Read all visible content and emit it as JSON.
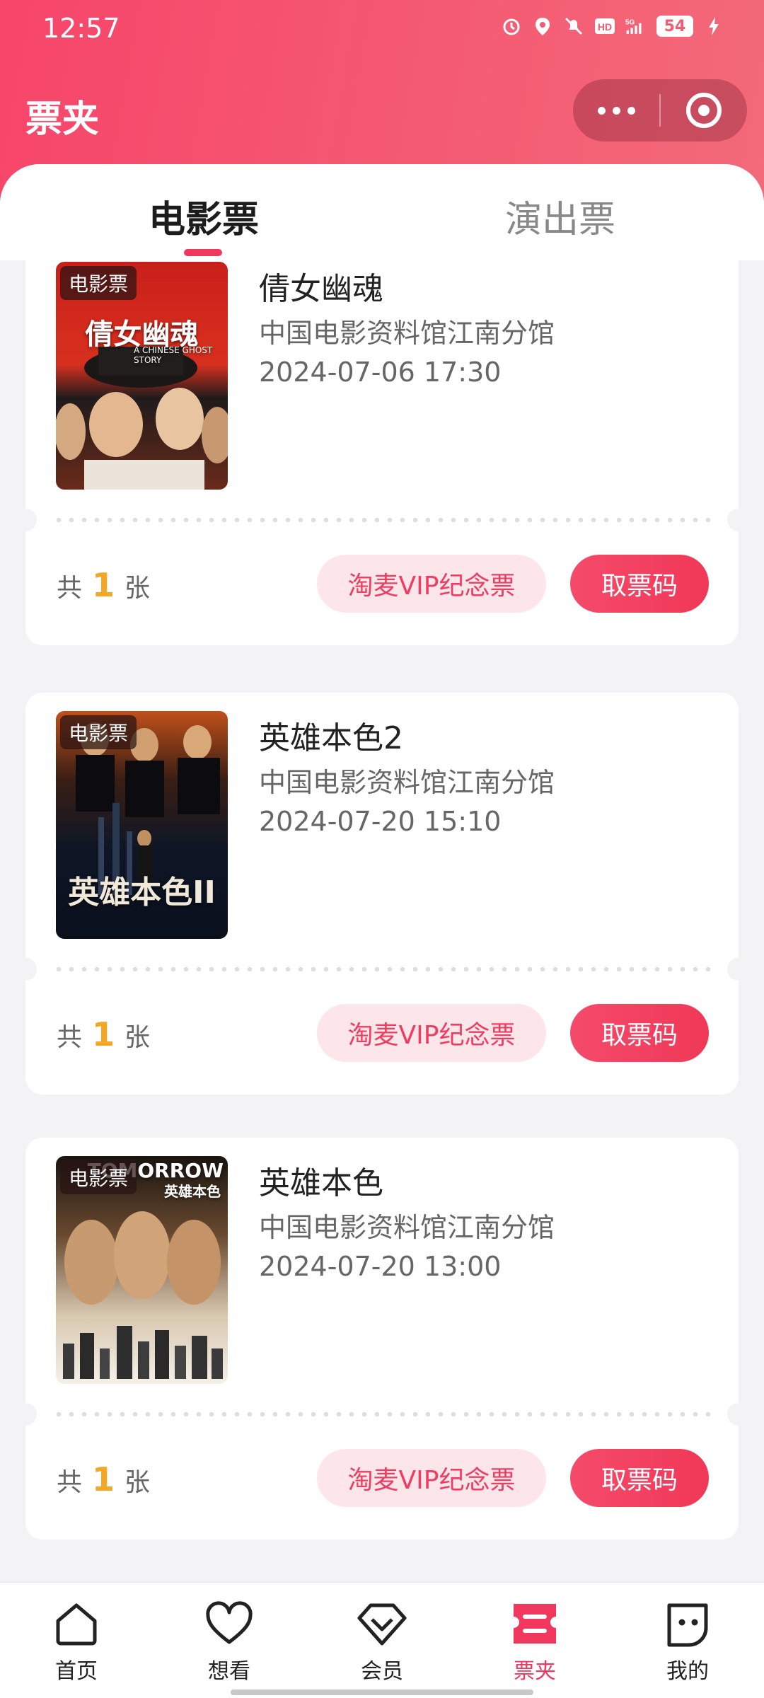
{
  "status_bar": {
    "time": "12:57",
    "icons": [
      "alarm-icon",
      "location-icon",
      "mute-icon",
      "hd-icon",
      "5g-signal-icon"
    ],
    "hd": "HD",
    "net": "5G",
    "battery": "54"
  },
  "header": {
    "title": "票夹",
    "capsule": {
      "more_icon": "more-dots-icon",
      "close_icon": "target-icon"
    }
  },
  "tabs": [
    {
      "label": "电影票",
      "active": true
    },
    {
      "label": "演出票",
      "active": false
    }
  ],
  "tickets": [
    {
      "badge": "电影票",
      "title": "倩女幽魂",
      "cinema": "中国电影资料馆江南分馆",
      "datetime": "2024-07-06 17:30",
      "count_prefix": "共",
      "count": "1",
      "count_suffix": "张",
      "vip_label": "淘麦VIP纪念票",
      "code_label": "取票码"
    },
    {
      "badge": "电影票",
      "title": "英雄本色2",
      "cinema": "中国电影资料馆江南分馆",
      "datetime": "2024-07-20 15:10",
      "count_prefix": "共",
      "count": "1",
      "count_suffix": "张",
      "vip_label": "淘麦VIP纪念票",
      "code_label": "取票码"
    },
    {
      "badge": "电影票",
      "title": "英雄本色",
      "cinema": "中国电影资料馆江南分馆",
      "datetime": "2024-07-20 13:00",
      "count_prefix": "共",
      "count": "1",
      "count_suffix": "张",
      "vip_label": "淘麦VIP纪念票",
      "code_label": "取票码"
    }
  ],
  "posters": {
    "p1_title": "倩女幽魂",
    "p1_sub": "A CHINESE GHOST STORY",
    "p2_title": "英雄本色II",
    "p3_title_en": "TOMORROW",
    "p3_title_cn": "英雄本色"
  },
  "bottom_nav": [
    {
      "label": "首页",
      "icon": "home-icon",
      "active": false
    },
    {
      "label": "想看",
      "icon": "heart-icon",
      "active": false
    },
    {
      "label": "会员",
      "icon": "member-icon",
      "active": false
    },
    {
      "label": "票夹",
      "icon": "ticket-wallet-icon",
      "active": true
    },
    {
      "label": "我的",
      "icon": "profile-icon",
      "active": false
    }
  ],
  "colors": {
    "accent": "#f0375e",
    "header_gradient_start": "#f7456a",
    "count_highlight": "#f5a623",
    "vip_bg": "#fde6ea"
  }
}
